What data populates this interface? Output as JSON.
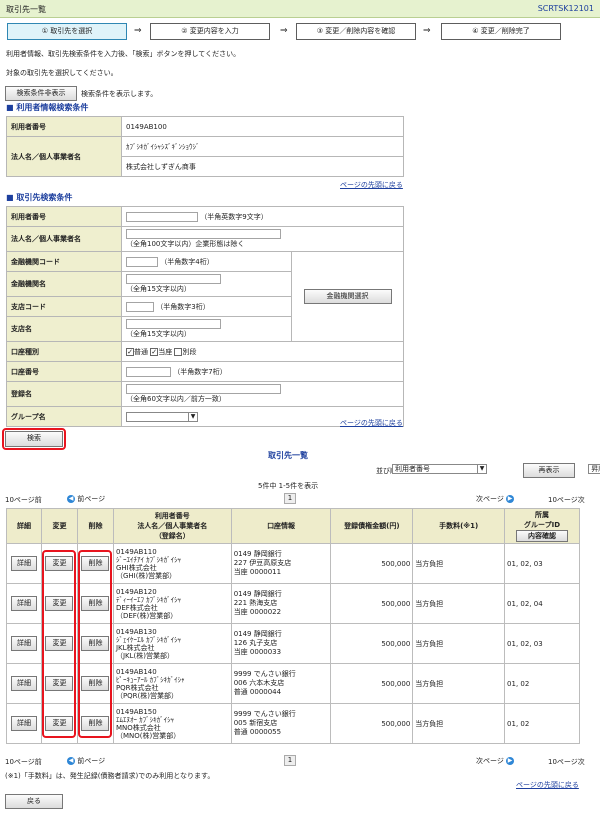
{
  "header": {
    "title": "取引先一覧",
    "code": "SCRTSK12101"
  },
  "steps": [
    {
      "label": "① 取引先を選択"
    },
    {
      "label": "② 変更内容を入力"
    },
    {
      "label": "③ 変更／削除内容を確認"
    },
    {
      "label": "④ 変更／削除完了"
    }
  ],
  "arrow": "⇒",
  "messages": {
    "line1": "利用者情報、取引先検索条件を入力後、「検索」ボタンを押してください。",
    "line2": "対象の取引先を選択してください。"
  },
  "toggle": {
    "button": "検索条件非表示",
    "note": "検索条件を表示します。"
  },
  "user_section": {
    "heading": "利用者情報検索条件",
    "user_no_label": "利用者番号",
    "user_no_value": "0149AB100",
    "corp_label": "法人名／個人事業者名",
    "corp_kana": "ｶﾌﾞｼｷｶﾞｲｼｬｼｽﾞｷﾞﾝｼｮｳｼﾞ",
    "corp_name": "株式会社しずぎん商事"
  },
  "page_top": "ページの先頭に戻る",
  "search_section": {
    "heading": "取引先検索条件",
    "user_no": {
      "label": "利用者番号",
      "hint": "（半角英数字9文字）"
    },
    "corp": {
      "label": "法人名／個人事業者名",
      "hint": "（全角100文字以内）企業形態は除く"
    },
    "bank_code": {
      "label": "金融機関コード",
      "hint": "（半角数字4桁）"
    },
    "bank_name": {
      "label": "金融機関名",
      "hint": "（全角15文字以内）"
    },
    "branch_code": {
      "label": "支店コード",
      "hint": "（半角数字3桁）"
    },
    "branch_name": {
      "label": "支店名",
      "hint": "（全角15文字以内）"
    },
    "bank_select": "金融機関選択",
    "acct_type": {
      "label": "口座種別",
      "opt1": "普通",
      "opt2": "当座",
      "opt3": "別段",
      "check1": "✓",
      "check2": "✓"
    },
    "acct_no": {
      "label": "口座番号",
      "hint": "（半角数字7桁）"
    },
    "reg_name": {
      "label": "登録名",
      "hint": "（全角60文字以内／前方一致）"
    },
    "group": {
      "label": "グループ名"
    }
  },
  "search_button": "検索",
  "list": {
    "title": "取引先一覧",
    "sort_label": "並び順:",
    "sort_value": "利用者番号",
    "order_value": "昇順",
    "redisplay": "再表示",
    "count": "5件中 1-5件を表示",
    "prev10": "10ページ前",
    "prev": "前ページ",
    "next": "次ページ",
    "next10": "10ページ次",
    "page": "1",
    "headers": {
      "detail": "詳細",
      "change": "変更",
      "delete": "削除",
      "user": "利用者番号\n法人名／個人事業者名\n（登録名）",
      "account": "口座情報",
      "limit": "登録債権金額(円)",
      "fee": "手数料(※1)",
      "group": "所属\nグループID",
      "group_btn": "内容確認"
    },
    "btn_detail": "詳細",
    "btn_change": "変更",
    "btn_delete": "削除",
    "rows": [
      {
        "user": "0149AB110\nｼﾞｰｴｲﾁｱｲ ｶﾌﾞｼｷｶﾞｲｼｬ\nGHI株式会社\n（GHI(株)営業部）",
        "account": "0149 静岡銀行\n227 伊豆高原支店\n当座 0000011",
        "limit": "500,000",
        "fee": "当方負担",
        "group": "01, 02, 03"
      },
      {
        "user": "0149AB120\nﾃﾞｨｰｲｰｴﾌ ｶﾌﾞｼｷｶﾞｲｼｬ\nDEF株式会社\n（DEF(株)営業部）",
        "account": "0149 静岡銀行\n221 熱海支店\n当座 0000022",
        "limit": "500,000",
        "fee": "当方負担",
        "group": "01, 02, 04"
      },
      {
        "user": "0149AB130\nｼﾞｪｲｹｰｴﾙ ｶﾌﾞｼｷｶﾞｲｼｬ\nJKL株式会社\n（JKL(株)営業部）",
        "account": "0149 静岡銀行\n126 丸子支店\n当座 0000033",
        "limit": "500,000",
        "fee": "当方負担",
        "group": "01, 02, 03"
      },
      {
        "user": "0149AB140\nﾋﾟｰｷｭｰｱｰﾙ ｶﾌﾞｼｷｶﾞｲｼｬ\nPQR株式会社\n（PQR(株)営業部）",
        "account": "9999 でんさい銀行\n006 六本木支店\n普通 0000044",
        "limit": "500,000",
        "fee": "当方負担",
        "group": "01, 02"
      },
      {
        "user": "0149AB150\nｴﾑｴﾇｵｰ ｶﾌﾞｼｷｶﾞｲｼｬ\nMNO株式会社\n（MNO(株)営業部）",
        "account": "9999 でんさい銀行\n005 新宿支店\n普通 0000055",
        "limit": "500,000",
        "fee": "当方負担",
        "group": "01, 02"
      }
    ],
    "note": "(※1)「手数料」は、発生記録(債務者請求)でのみ利用となります。"
  },
  "back_button": "戻る"
}
